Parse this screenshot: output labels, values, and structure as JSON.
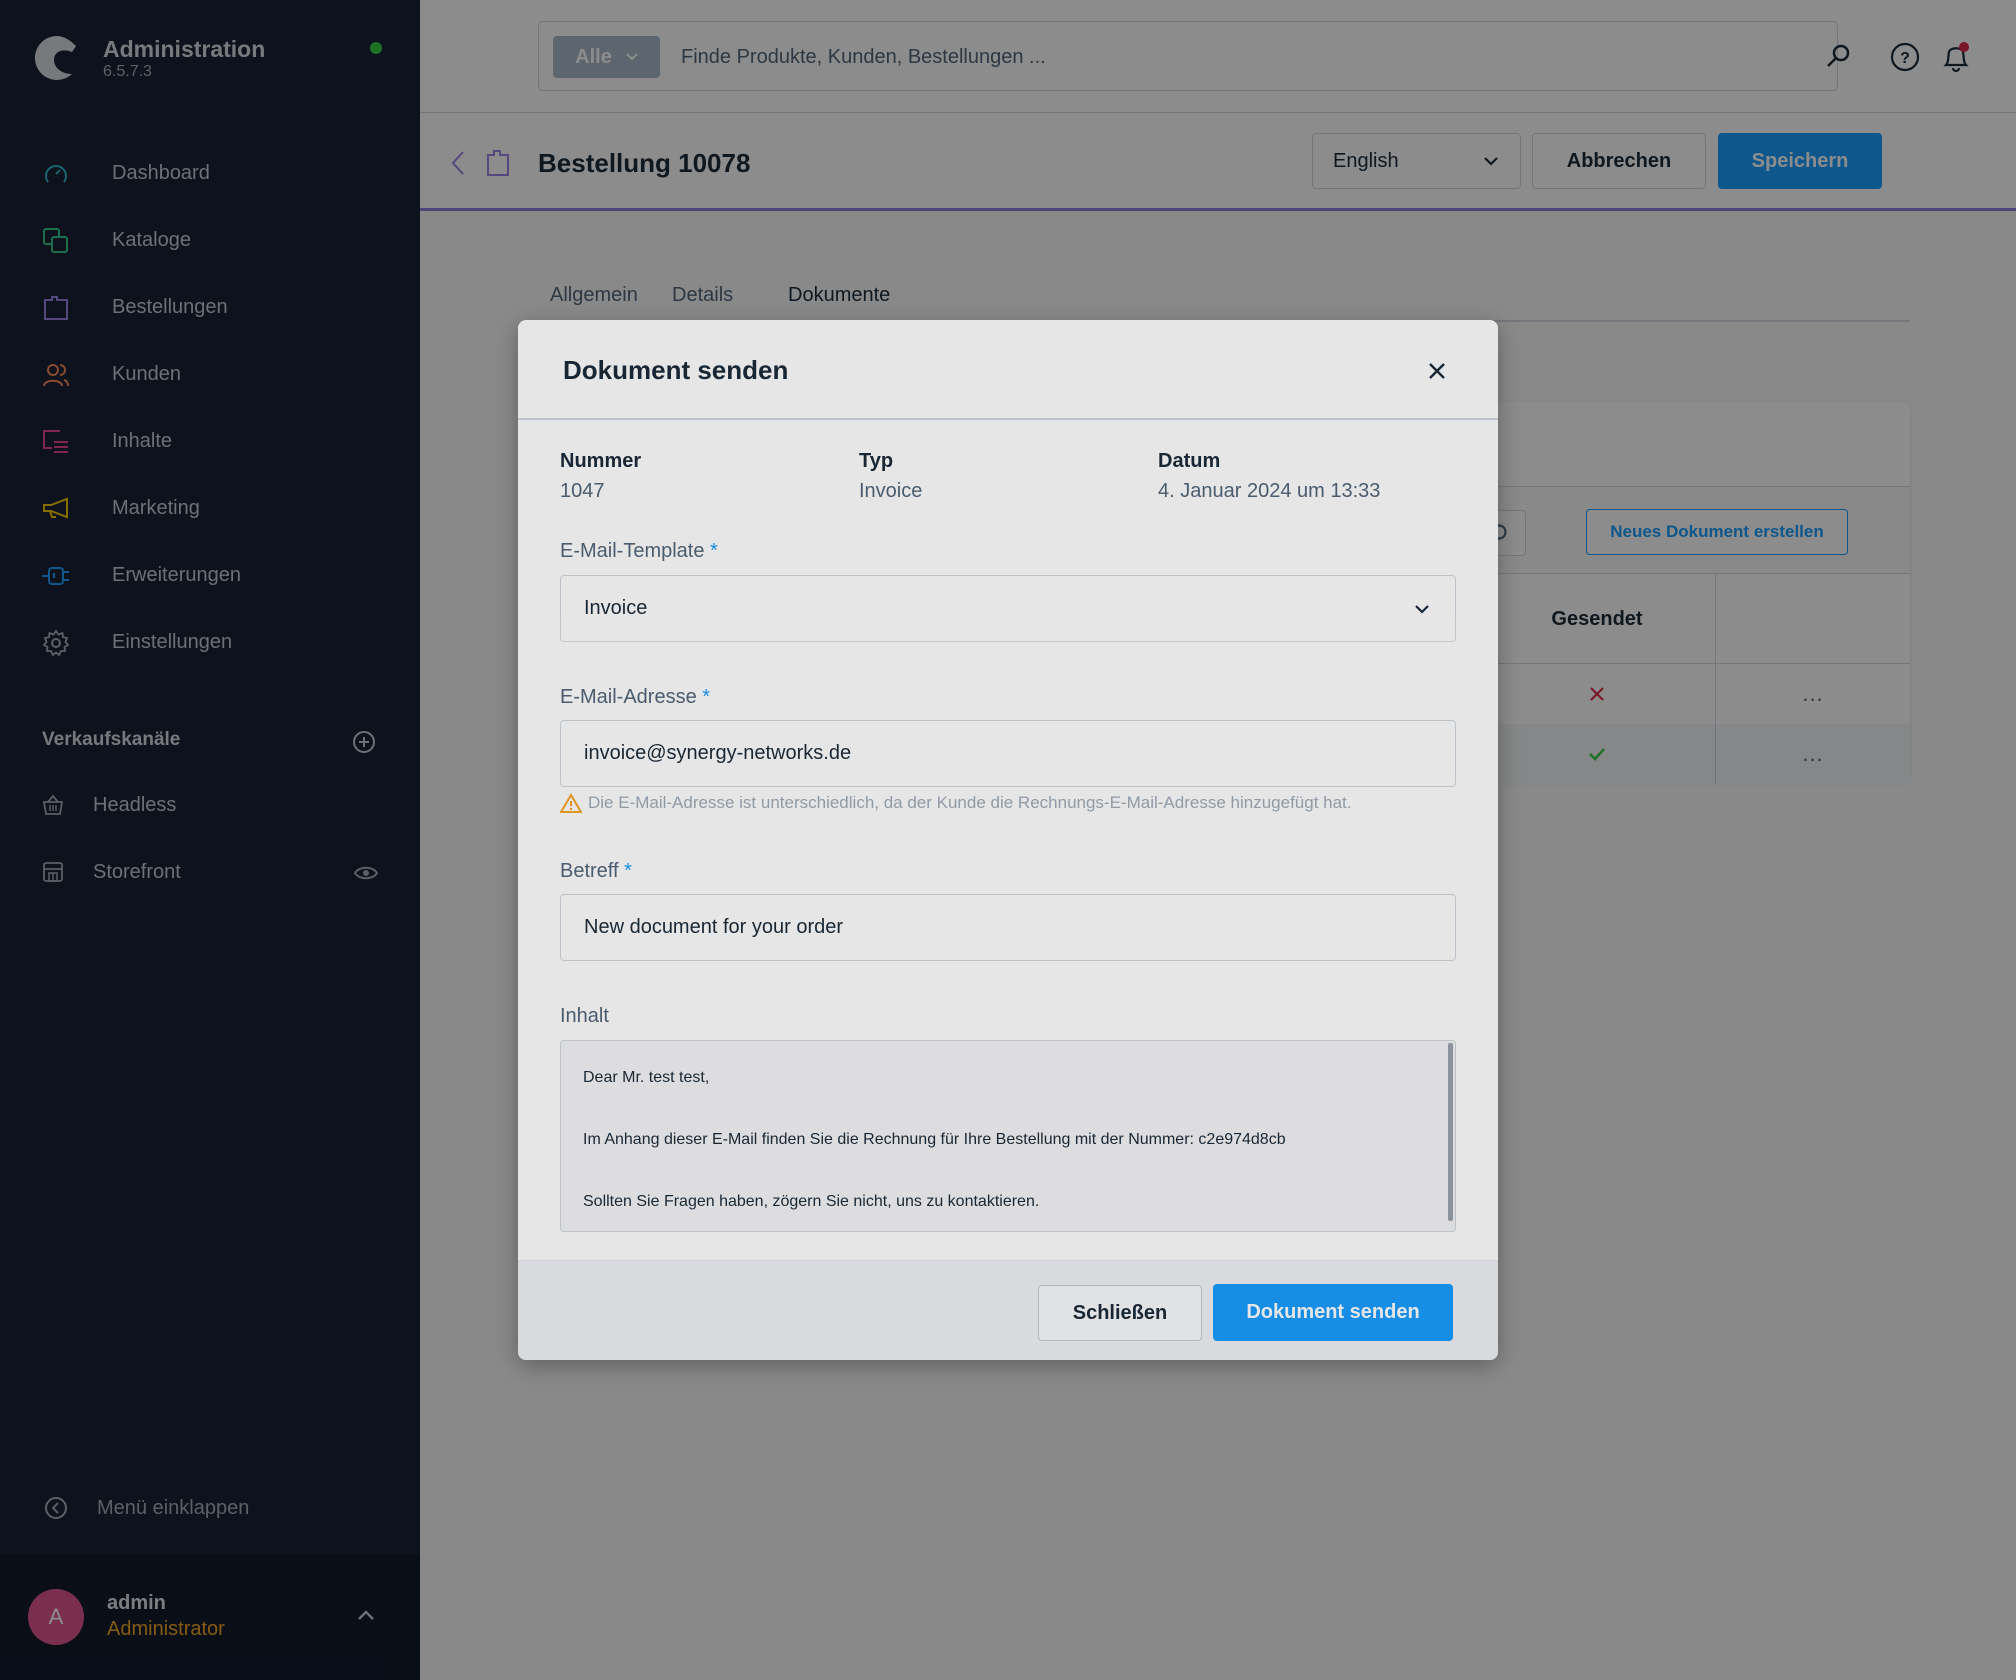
{
  "sidebar": {
    "app_title": "Administration",
    "version": "6.5.7.3",
    "nav": [
      {
        "label": "Dashboard",
        "icon": "dashboard-icon",
        "color": "#2bb5c9"
      },
      {
        "label": "Kataloge",
        "icon": "catalog-icon",
        "color": "#37c98d"
      },
      {
        "label": "Bestellungen",
        "icon": "orders-icon",
        "color": "#9d82e8"
      },
      {
        "label": "Kunden",
        "icon": "customers-icon",
        "color": "#f5895a"
      },
      {
        "label": "Inhalte",
        "icon": "content-icon",
        "color": "#e8478f"
      },
      {
        "label": "Marketing",
        "icon": "marketing-icon",
        "color": "#f5c800"
      },
      {
        "label": "Erweiterungen",
        "icon": "extensions-icon",
        "color": "#189eff"
      },
      {
        "label": "Einstellungen",
        "icon": "settings-icon",
        "color": "#a8afb9"
      }
    ],
    "sales_channels_title": "Verkaufskanäle",
    "sales_channels": [
      {
        "label": "Headless",
        "icon": "basket-icon"
      },
      {
        "label": "Storefront",
        "icon": "storefront-icon"
      }
    ],
    "collapse_label": "Menü einklappen",
    "user": {
      "initial": "A",
      "name": "admin",
      "role": "Administrator"
    }
  },
  "topbar": {
    "search_type": "Alle",
    "search_placeholder": "Finde Produkte, Kunden, Bestellungen ..."
  },
  "header": {
    "title": "Bestellung 10078",
    "language": "English",
    "cancel_label": "Abbrechen",
    "save_label": "Speichern"
  },
  "tabs": [
    {
      "label": "Allgemein",
      "active": false
    },
    {
      "label": "Details",
      "active": false
    },
    {
      "label": "Dokumente",
      "active": true
    }
  ],
  "documents_card": {
    "new_document_label": "Neues Dokument erstellen",
    "sent_column": "Gesendet",
    "rows": [
      {
        "sent": false,
        "actions": "..."
      },
      {
        "sent": true,
        "actions": "..."
      }
    ]
  },
  "modal": {
    "title": "Dokument senden",
    "meta": {
      "number_label": "Nummer",
      "number_value": "1047",
      "type_label": "Typ",
      "type_value": "Invoice",
      "date_label": "Datum",
      "date_value": "4. Januar 2024 um 13:33"
    },
    "template_label": "E-Mail-Template",
    "template_value": "Invoice",
    "email_label": "E-Mail-Adresse",
    "email_value": "invoice@synergy-networks.de",
    "email_hint": "Die E-Mail-Adresse ist unterschiedlich, da der Kunde die Rechnungs-E-Mail-Adresse hinzugefügt hat.",
    "subject_label": "Betreff",
    "subject_value": "New document for your order",
    "content_label": "Inhalt",
    "content_lines": [
      "Dear Mr. test test,",
      "Im Anhang dieser E-Mail finden Sie die Rechnung für Ihre Bestellung mit der Nummer: c2e974d8cb",
      "Sollten Sie Fragen haben, zögern Sie nicht, uns zu kontaktieren."
    ],
    "required_mark": "*",
    "close_label": "Schließen",
    "send_label": "Dokument senden"
  }
}
